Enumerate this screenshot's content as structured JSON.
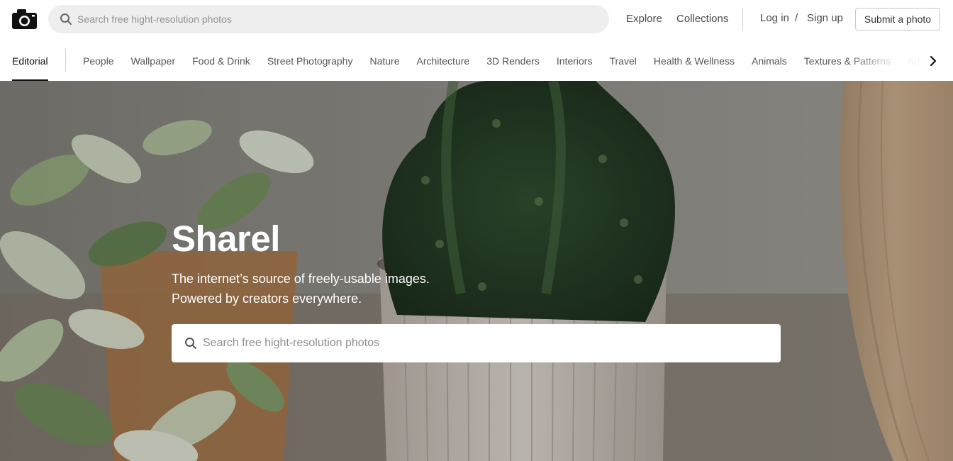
{
  "header": {
    "logo_icon": "camera-icon",
    "search": {
      "placeholder": "Search free hight-resolution photos",
      "icon": "search-icon"
    },
    "nav": {
      "explore": "Explore",
      "collections": "Collections"
    },
    "auth": {
      "login": "Log in",
      "separator": "/",
      "signup": "Sign up"
    },
    "submit_label": "Submit a photo"
  },
  "categories": {
    "active": "Editorial",
    "items": [
      "People",
      "Wallpaper",
      "Food & Drink",
      "Street Photography",
      "Nature",
      "Architecture",
      "3D Renders",
      "Interiors",
      "Travel",
      "Health & Wellness",
      "Animals",
      "Textures & Patterns",
      "Art"
    ],
    "next_icon": "chevron-right-icon"
  },
  "hero": {
    "title": "Sharel",
    "subtitle_line1": "The internet’s source of freely-usable images.",
    "subtitle_line2": "Powered by creators everywhere.",
    "search": {
      "placeholder": "Search free hight-resolution photos",
      "icon": "search-icon"
    },
    "background": "plants-photo"
  },
  "colors": {
    "accent": "#111111",
    "search_bg": "#eeeeee",
    "hero_text": "#ffffff"
  }
}
